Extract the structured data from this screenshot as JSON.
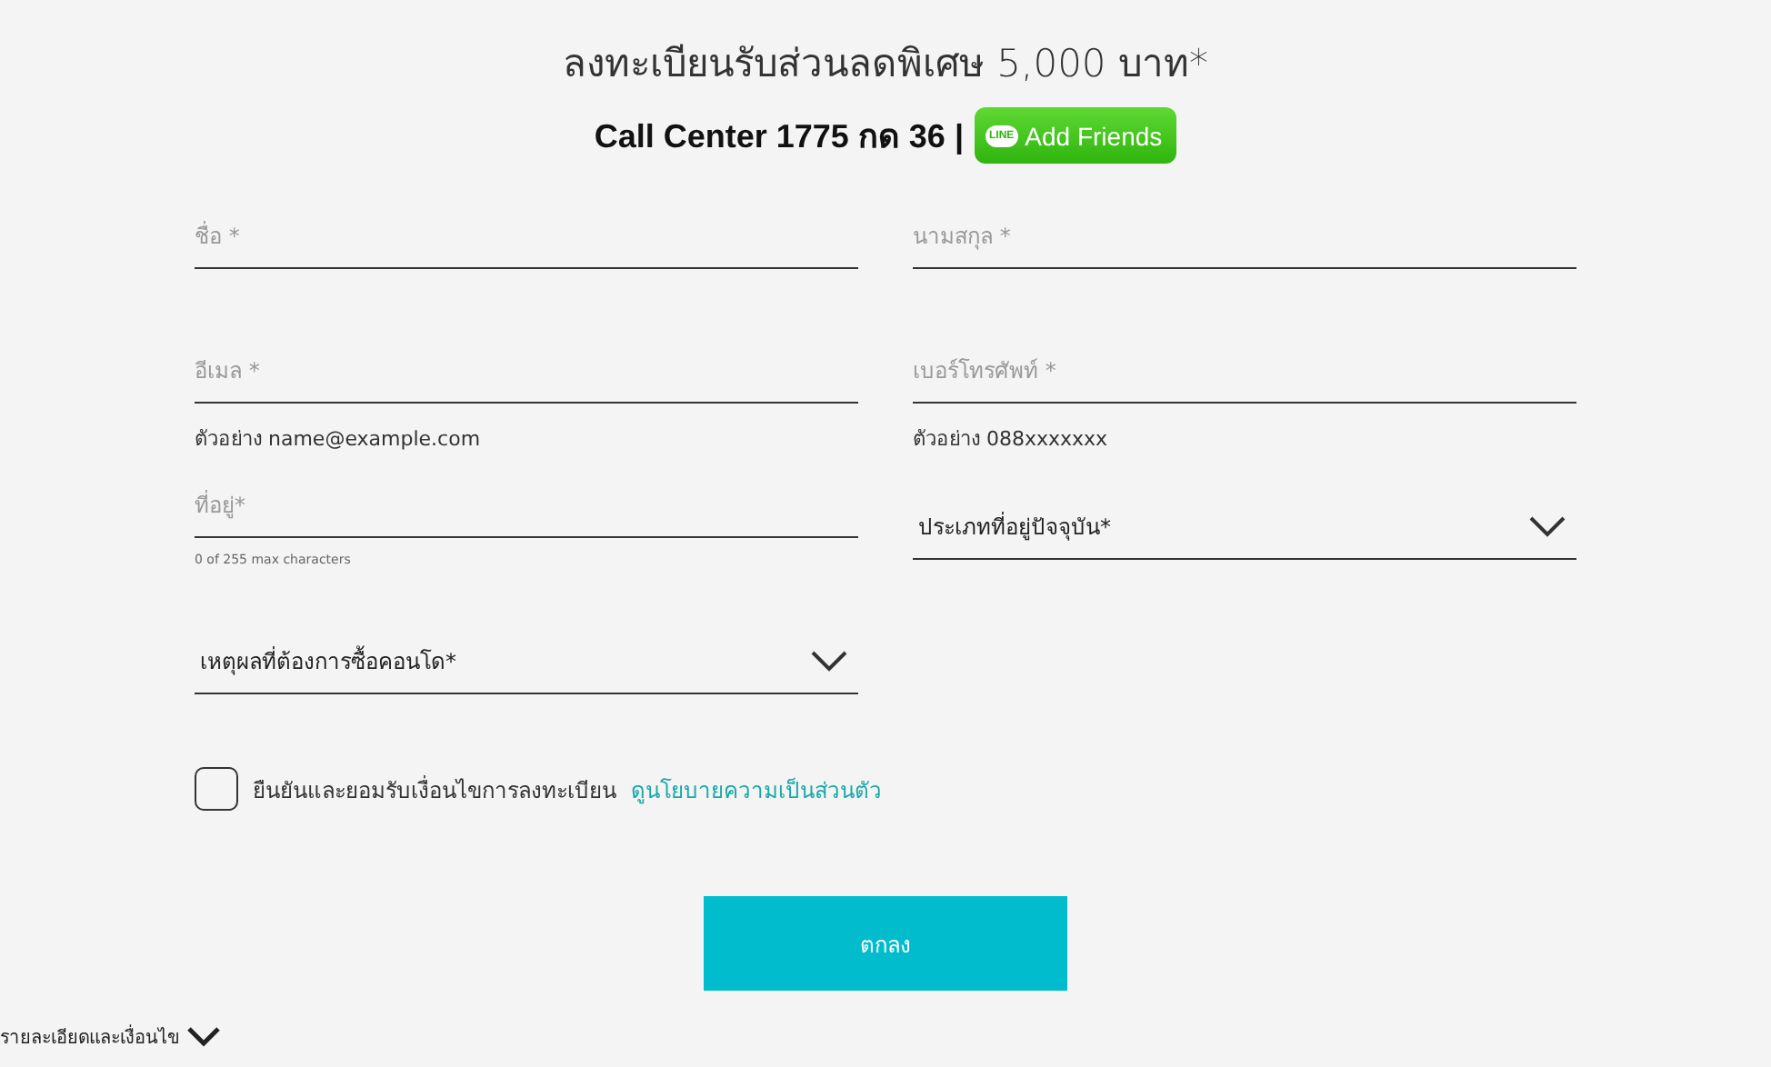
{
  "heading": "ลงทะเบียนรับส่วนลดพิเศษ 5,000 บาท*",
  "call_center": "Call Center 1775 กด 36 |",
  "line_button": {
    "badge": "LINE",
    "label": "Add Friends"
  },
  "fields": [
    {
      "kind": "text",
      "placeholder": "ชื่อ *"
    },
    {
      "kind": "text",
      "placeholder": "นามสกุล *"
    },
    {
      "kind": "text",
      "placeholder": "อีเมล *",
      "hint": "ตัวอย่าง name@example.com"
    },
    {
      "kind": "text",
      "placeholder": "เบอร์โทรศัพท์ *",
      "hint": "ตัวอย่าง 088xxxxxxx"
    },
    {
      "kind": "text",
      "placeholder": "ที่อยู่*",
      "counter": "0 of 255 max characters"
    },
    {
      "kind": "select",
      "label": "ประเภทที่อยู่ปัจจุบัน*"
    },
    {
      "kind": "select",
      "label": "เหตุผลที่ต้องการซื้อคอนโด*"
    }
  ],
  "consent": {
    "checked": false,
    "label": "ยืนยันและยอมรับเงื่อนไขการลงทะเบียน",
    "link": "ดูนโยบายความเป็นส่วนตัว"
  },
  "submit": "ตกลง",
  "footer_toggle": "รายละเอียดและเงื่อนไข"
}
